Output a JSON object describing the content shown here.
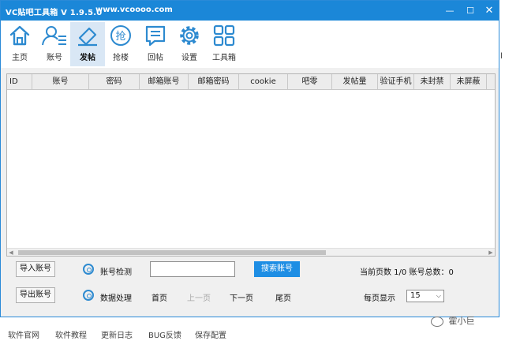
{
  "titlebar": {
    "title": "VC贴吧工具箱 V 1.9.5.0",
    "site": "www.vcoooo.com",
    "minimize_glyph": "—",
    "maximize_glyph": "☐",
    "close_glyph": "✕"
  },
  "toolbar": {
    "items": [
      {
        "label": "主页",
        "icon": "home-icon"
      },
      {
        "label": "账号",
        "icon": "user-list-icon"
      },
      {
        "label": "发帖",
        "icon": "pen-edit-icon",
        "active": true
      },
      {
        "label": "抢楼",
        "icon": "grab-circle-icon",
        "glyph": "抢"
      },
      {
        "label": "回帖",
        "icon": "reply-doc-icon"
      },
      {
        "label": "设置",
        "icon": "gear-icon"
      },
      {
        "label": "工具箱",
        "icon": "grid-apps-icon"
      }
    ]
  },
  "table": {
    "columns": [
      "ID",
      "账号",
      "密码",
      "邮箱账号",
      "邮箱密码",
      "cookie",
      "吧零",
      "发帖量",
      "验证手机",
      "未封禁",
      "未屏蔽"
    ],
    "rows": []
  },
  "controls": {
    "import_button": "导入账号",
    "export_button": "导出账号",
    "check_label": "账号检测",
    "process_label": "数据处理",
    "search_value": "",
    "search_button": "搜索账号",
    "page_first": "首页",
    "page_prev": "上一页",
    "page_next": "下一页",
    "page_last": "尾页",
    "page_info": "当前页数 1/0  账号总数：0",
    "per_page_label": "每页显示",
    "per_page_value": "15"
  },
  "footer": {
    "links": [
      "软件官网",
      "软件教程",
      "更新日志",
      "BUG反馈",
      "保存配置"
    ],
    "brand": "霍小巨"
  },
  "edge_mark": "l",
  "colors": {
    "titlebar": "#1b87d8",
    "accent_button": "#1e8ee4",
    "icon_blue": "#2d8ad0",
    "active_tab": "#d9e7f5"
  }
}
